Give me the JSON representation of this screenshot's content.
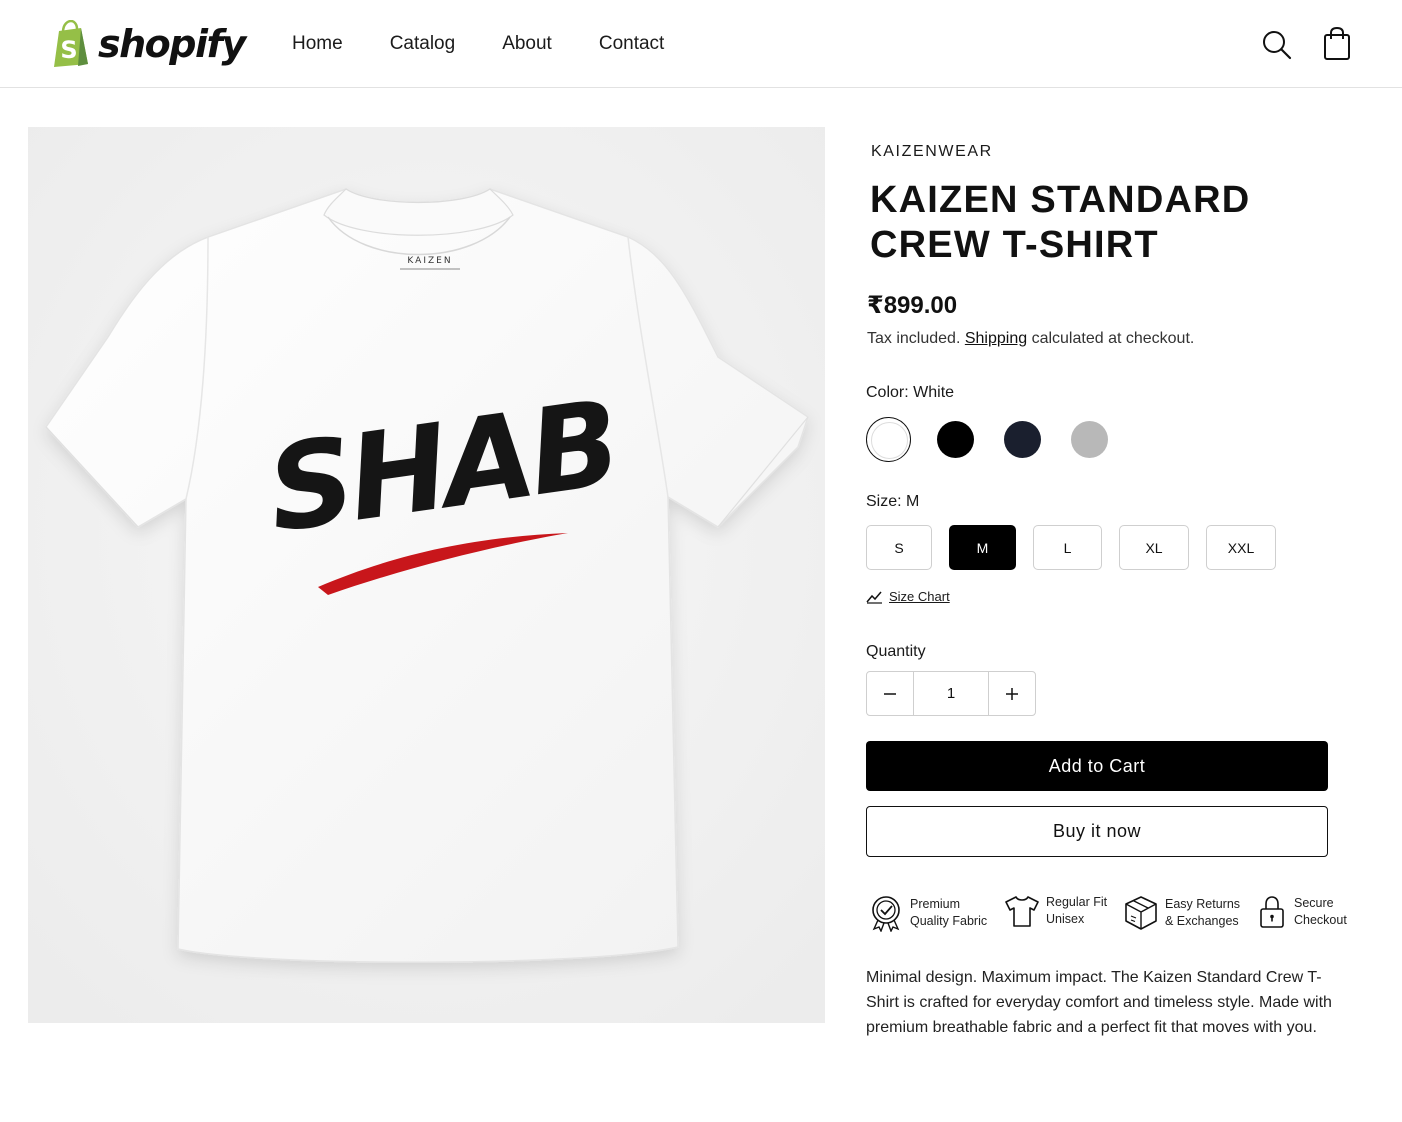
{
  "header": {
    "logo_text": "shopify",
    "nav": [
      "Home",
      "Catalog",
      "About",
      "Contact"
    ],
    "icons": [
      "search-icon",
      "shopping-bag-icon"
    ]
  },
  "product": {
    "image": {
      "print_text": "SHAB",
      "neck_label": "KAIZEN",
      "accent_color": "#c8161b",
      "shirt_color": "#ffffff"
    },
    "vendor": "KAIZENWEAR",
    "title": "KAIZEN STANDARD CREW T-SHIRT",
    "price": "₹899.00",
    "tax_prefix": "Tax included.",
    "tax_link": "Shipping",
    "tax_suffix": "calculated at checkout.",
    "color": {
      "label": "Color:",
      "selected": "White",
      "swatches": [
        "#ffffff",
        "#000000",
        "#1a1f2e",
        "#b8b8b8"
      ]
    },
    "size": {
      "label": "Size:",
      "selected": "M",
      "options": [
        "S",
        "M",
        "L",
        "XL",
        "XXL"
      ]
    },
    "size_chart": "Size Chart",
    "quantity": {
      "label": "Quantity",
      "value": "1"
    },
    "add_to_cart": "Add to Cart",
    "buy_now": "Buy it now",
    "features": [
      {
        "icon": "badge-check-icon",
        "line1": "Premium",
        "line2": "Quality Fabric"
      },
      {
        "icon": "tshirt-icon",
        "line1": "Regular Fit",
        "line2": "Unisex"
      },
      {
        "icon": "box-icon",
        "line1": "Easy Returns",
        "line2": "& Exchanges"
      },
      {
        "icon": "lock-icon",
        "line1": "Secure",
        "line2": "Checkout"
      }
    ],
    "description": "Minimal design. Maximum impact. The Kaizen Standard Crew T-Shirt is crafted for everyday comfort and timeless style. Made with premium breathable fabric and a perfect fit that moves with you."
  }
}
